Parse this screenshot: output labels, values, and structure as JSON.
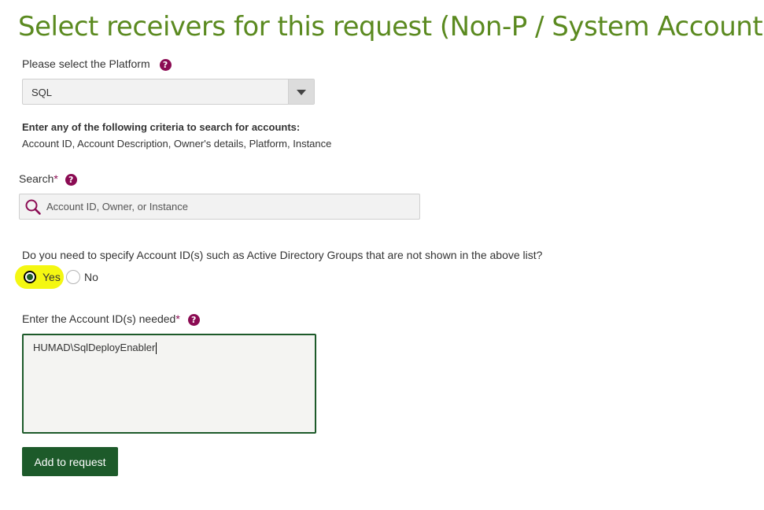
{
  "page": {
    "title": "Select receivers for this request (Non-P / System Accounts)"
  },
  "platform": {
    "label": "Please select the Platform",
    "selected": "SQL"
  },
  "criteria": {
    "title": "Enter any of the following criteria to search for accounts:",
    "fields": "Account ID, Account Description, Owner's details, Platform, Instance"
  },
  "search": {
    "label": "Search",
    "required_mark": "*",
    "placeholder": "Account ID, Owner, or Instance"
  },
  "question": {
    "text": "Do you need to specify Account ID(s) such as Active Directory Groups that are not shown in the above list?",
    "yes_label": "Yes",
    "no_label": "No",
    "selected": "Yes"
  },
  "account_ids": {
    "label": "Enter the Account ID(s) needed",
    "required_mark": "*",
    "value": "HUMAD\\SqlDeployEnabler"
  },
  "actions": {
    "add_label": "Add to request"
  },
  "help_glyph": "?",
  "colors": {
    "title_green": "#5b8a20",
    "dark_green": "#1d5a2a",
    "help_purple": "#8b0b53",
    "highlight_yellow": "#f4f712"
  },
  "icons": [
    "help-icon",
    "dropdown-arrow-icon",
    "search-icon"
  ]
}
